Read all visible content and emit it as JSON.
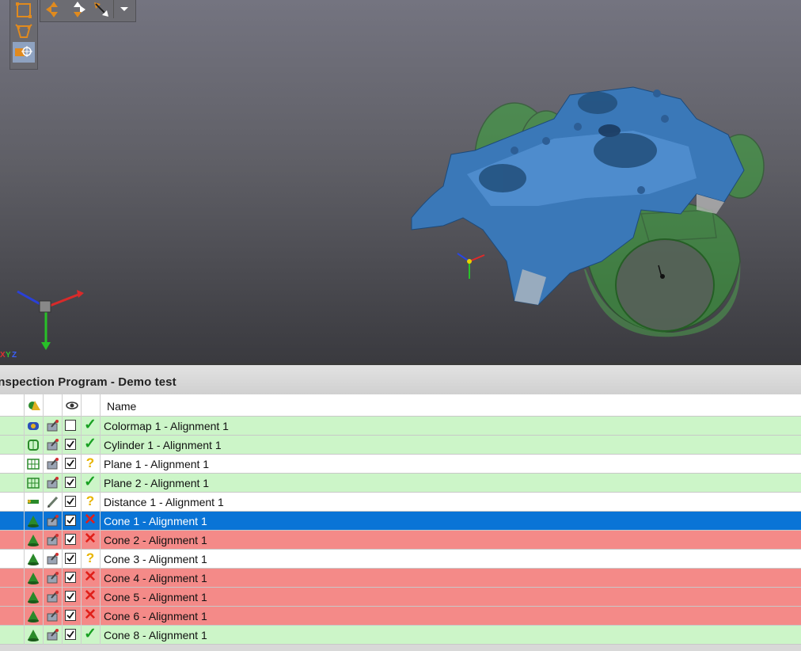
{
  "axis_label": "XYZ",
  "panel": {
    "title": "Inspection Program - Demo test"
  },
  "table": {
    "columns": {
      "name": "Name"
    },
    "rows": [
      {
        "name": "Colormap 1 - Alignment 1",
        "type_icon": "colormap-icon",
        "method_icon": "probe-icon",
        "visible": false,
        "status": "ok",
        "bg": "green"
      },
      {
        "name": "Cylinder 1 - Alignment 1",
        "type_icon": "cylinder-icon",
        "method_icon": "probe-icon",
        "visible": true,
        "status": "ok",
        "bg": "green"
      },
      {
        "name": "Plane 1 - Alignment 1",
        "type_icon": "plane-icon",
        "method_icon": "probe-icon",
        "visible": true,
        "status": "unknown",
        "bg": "white"
      },
      {
        "name": "Plane 2 - Alignment 1",
        "type_icon": "plane-icon",
        "method_icon": "probe-icon",
        "visible": true,
        "status": "ok",
        "bg": "green"
      },
      {
        "name": "Distance 1 - Alignment 1",
        "type_icon": "distance-icon",
        "method_icon": "pencil-icon",
        "visible": true,
        "status": "unknown",
        "bg": "white"
      },
      {
        "name": "Cone 1 - Alignment 1",
        "type_icon": "cone-icon",
        "method_icon": "probe-icon",
        "visible": true,
        "status": "fail",
        "bg": "selected"
      },
      {
        "name": "Cone 2 - Alignment 1",
        "type_icon": "cone-icon",
        "method_icon": "probe-icon",
        "visible": true,
        "status": "fail",
        "bg": "red"
      },
      {
        "name": "Cone 3 - Alignment 1",
        "type_icon": "cone-icon",
        "method_icon": "probe-icon",
        "visible": true,
        "status": "unknown",
        "bg": "white"
      },
      {
        "name": "Cone 4 - Alignment 1",
        "type_icon": "cone-icon",
        "method_icon": "probe-icon",
        "visible": true,
        "status": "fail",
        "bg": "red"
      },
      {
        "name": "Cone 5 - Alignment 1",
        "type_icon": "cone-icon",
        "method_icon": "probe-icon",
        "visible": true,
        "status": "fail",
        "bg": "red"
      },
      {
        "name": "Cone 6 - Alignment 1",
        "type_icon": "cone-icon",
        "method_icon": "probe-icon",
        "visible": true,
        "status": "fail",
        "bg": "red"
      },
      {
        "name": "Cone 8 - Alignment 1",
        "type_icon": "cone-icon",
        "method_icon": "probe-icon",
        "visible": true,
        "status": "ok",
        "bg": "green"
      }
    ]
  },
  "status_glyphs": {
    "ok": "✓",
    "fail": "✕",
    "unknown": "?"
  },
  "colors": {
    "ok_row": "#ccf5c8",
    "fail_row": "#f48a88",
    "selected_row": "#0a74d6",
    "part_blue": "#3a78b8",
    "cone_green": "#3aa83a"
  }
}
